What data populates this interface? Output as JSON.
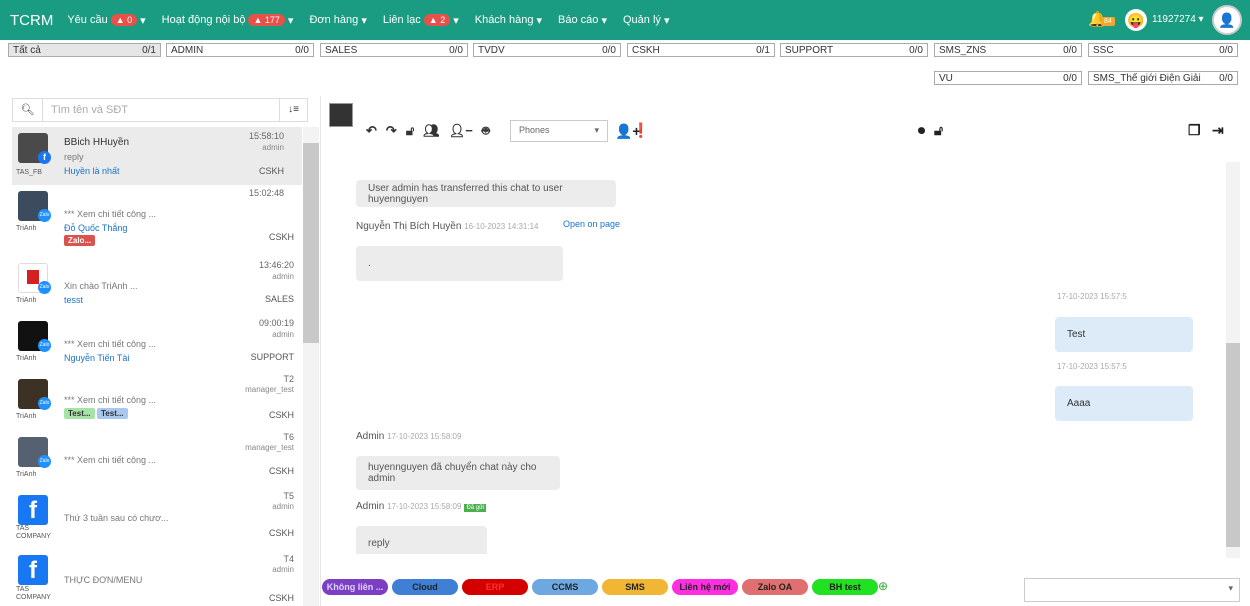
{
  "brand": "TCRM",
  "nav": [
    {
      "label": "Yêu cầu",
      "badge": "0"
    },
    {
      "label": "Hoạt động nội bộ",
      "badge": "177"
    },
    {
      "label": "Đơn hàng",
      "badge": ""
    },
    {
      "label": "Liên lạc",
      "badge": "2"
    },
    {
      "label": "Khách hàng",
      "badge": ""
    },
    {
      "label": "Báo cáo",
      "badge": ""
    },
    {
      "label": "Quản lý",
      "badge": ""
    }
  ],
  "user": {
    "notif": "84",
    "id": "11927274"
  },
  "queues": [
    {
      "label": "Tất cả",
      "count": "0/1"
    },
    {
      "label": "ADMIN",
      "count": "0/0"
    },
    {
      "label": "SALES",
      "count": "0/0"
    },
    {
      "label": "TVDV",
      "count": "0/0"
    },
    {
      "label": "CSKH",
      "count": "0/1"
    },
    {
      "label": "SUPPORT",
      "count": "0/0"
    },
    {
      "label": "SMS_ZNS",
      "count": "0/0"
    },
    {
      "label": "SSC",
      "count": "0/0"
    },
    {
      "label": "VU",
      "count": "0/0"
    },
    {
      "label": "SMS_Thế giới Điện Giải",
      "count": "0/0"
    }
  ],
  "search": {
    "placeholder": "Tìm tên và SĐT"
  },
  "contacts": [
    {
      "source": "TAS_FB",
      "name": "BBich HHuyền",
      "preview": "reply",
      "agent": "Huyền là nhất",
      "time": "15:58:10",
      "staff": "admin",
      "group": "CSKH",
      "tags": []
    },
    {
      "source": "TriAnh",
      "name": "",
      "preview": "*** Xem chi tiết công ...",
      "agent": "Đỗ Quốc Thắng",
      "time": "15:02:48",
      "staff": "",
      "group": "CSKH",
      "tags": [
        "Zalo..."
      ]
    },
    {
      "source": "TriAnh",
      "name": "",
      "preview": "Xin chào TriAnh ...",
      "agent": "tesst",
      "time": "13:46:20",
      "staff": "admin",
      "group": "SALES",
      "tags": []
    },
    {
      "source": "TriAnh",
      "name": "",
      "preview": "*** Xem chi tiết công ...",
      "agent": "Nguyễn Tiến Tài",
      "time": "09:00:19",
      "staff": "admin",
      "group": "SUPPORT",
      "tags": []
    },
    {
      "source": "TriAnh",
      "name": "",
      "preview": "*** Xem chi tiết công ...",
      "agent": "",
      "time": "T2",
      "staff": "manager_test",
      "group": "CSKH",
      "tags": [
        "Test...",
        "Test..."
      ]
    },
    {
      "source": "TriAnh",
      "name": "",
      "preview": "*** Xem chi tiết công ...",
      "agent": "",
      "time": "T6",
      "staff": "manager_test",
      "group": "CSKH",
      "tags": []
    },
    {
      "source": "TAS COMPANY",
      "name": "",
      "preview": "Thứ 3 tuần sau có chươ...",
      "agent": "",
      "time": "T5",
      "staff": "admin",
      "group": "CSKH",
      "tags": []
    },
    {
      "source": "TAS COMPANY",
      "name": "",
      "preview": "THỰC ĐƠN/MENU",
      "agent": "",
      "time": "T4",
      "staff": "admin",
      "group": "CSKH",
      "tags": []
    }
  ],
  "chat": {
    "phones_placeholder": "Phones",
    "messages": [
      {
        "text": "User admin has transferred this chat to user huyennguyen"
      },
      {
        "author": "Nguyễn Thị Bích Huyền",
        "time": "16-10-2023 14:31:14",
        "link": "Open on page",
        "text": "."
      },
      {
        "time": "17-10-2023 15:57:5",
        "text": "Test"
      },
      {
        "time": "17-10-2023 15:57:5",
        "text": "Aaaa"
      },
      {
        "author": "Admin",
        "time": "17-10-2023 15:58:09",
        "text": "huyennguyen đã chuyển chat này cho admin"
      },
      {
        "author": "Admin",
        "time": "17-10-2023 15:58:09",
        "seen": "Đã gửi",
        "text": "reply"
      }
    ]
  },
  "quick_tags": [
    {
      "label": "Không liên ...",
      "color": "#7b3fc4"
    },
    {
      "label": "Cloud",
      "color": "#3f7fd6"
    },
    {
      "label": "ERP",
      "color": "#d40000"
    },
    {
      "label": "CCMS",
      "color": "#6ea8e0"
    },
    {
      "label": "SMS",
      "color": "#f1b634"
    },
    {
      "label": "Liên hệ mới",
      "color": "#ff2ee0"
    },
    {
      "label": "Zalo OA",
      "color": "#e07070"
    },
    {
      "label": "BH test",
      "color": "#22e022"
    }
  ]
}
